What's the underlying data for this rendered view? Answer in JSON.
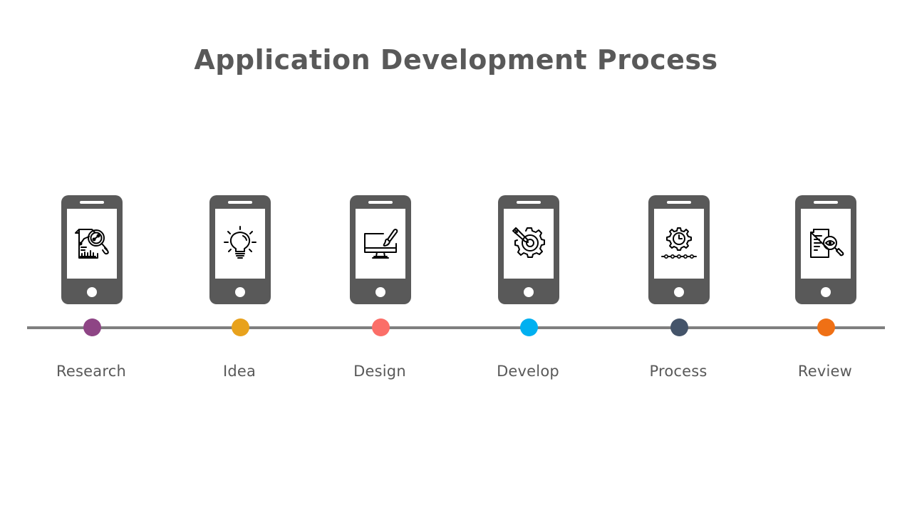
{
  "title": "Application Development Process",
  "steps": [
    {
      "label": "Research",
      "icon": "research-report-magnifier-icon",
      "color": "#8e4585"
    },
    {
      "label": "Idea",
      "icon": "lightbulb-icon",
      "color": "#e8a21d"
    },
    {
      "label": "Design",
      "icon": "monitor-paintbrush-icon",
      "color": "#fb6e68"
    },
    {
      "label": "Develop",
      "icon": "gear-pencil-target-icon",
      "color": "#00b0f0"
    },
    {
      "label": "Process",
      "icon": "gear-clock-timeline-icon",
      "color": "#44546a"
    },
    {
      "label": "Review",
      "icon": "document-eye-magnifier-icon",
      "color": "#ef7015"
    }
  ],
  "colors": {
    "phone": "#595959",
    "timeline": "#7f7f7f",
    "text": "#595959"
  }
}
